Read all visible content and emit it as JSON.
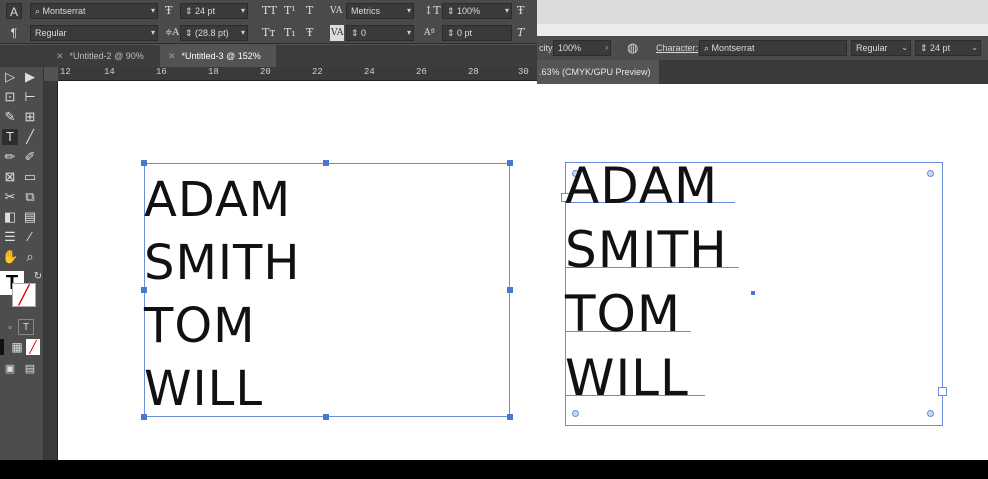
{
  "left_window": {
    "control_bar": {
      "font_family": "Montserrat",
      "font_size": "24 pt",
      "kerning": "Metrics",
      "vertical_scale": "100%",
      "font_style": "Regular",
      "leading": "(28.8 pt)",
      "tracking": "0",
      "baseline_shift": "0 pt"
    },
    "tabs": [
      {
        "label": "*Untitled-2 @ 90%"
      },
      {
        "label": "*Untitled-3 @ 152%"
      }
    ],
    "ruler_ticks": [
      "12",
      "14",
      "16",
      "18",
      "20",
      "22",
      "24",
      "26",
      "28",
      "30"
    ],
    "text_lines": [
      "ADAM",
      "SMITH",
      "TOM",
      "WILL"
    ]
  },
  "right_window": {
    "control_bar": {
      "opacity_label": "city:",
      "opacity_value": "100%",
      "character_label": "Character:",
      "font_family": "Montserrat",
      "font_style": "Regular",
      "font_size": "24 pt"
    },
    "tab_label": ".63% (CMYK/GPU Preview)",
    "text_lines": [
      "ADAM",
      "SMITH",
      "TOM",
      "WILL"
    ]
  },
  "colors": {
    "selection_blue": "#6a8fd8",
    "panel_dark": "#4a4a4a",
    "canvas": "#ffffff"
  }
}
